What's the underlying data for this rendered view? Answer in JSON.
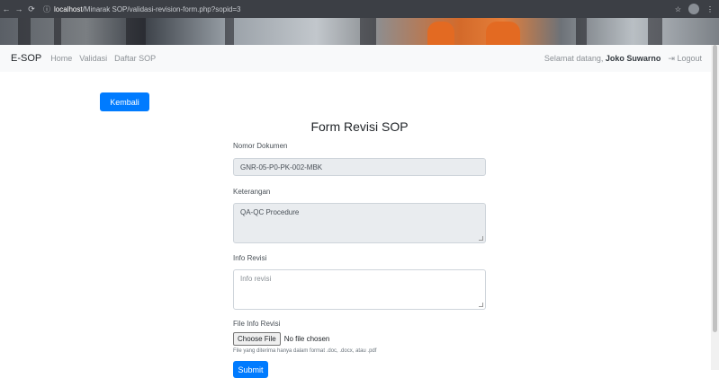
{
  "browser": {
    "url_host": "localhost",
    "url_path": "/Minarak SOP/validasi-revision-form.php?sopid=3"
  },
  "navbar": {
    "brand": "E-SOP",
    "links": [
      "Home",
      "Validasi",
      "Daftar SOP"
    ],
    "greeting": "Selamat datang,",
    "user_name": "Joko Suwarno",
    "logout": "Logout"
  },
  "back_button": "Kembali",
  "form": {
    "title": "Form Revisi SOP",
    "nomor_label": "Nomor Dokumen",
    "nomor_value": "GNR-05-P0-PK-002-MBK",
    "keterangan_label": "Keterangan",
    "keterangan_value": "QA-QC Procedure",
    "info_label": "Info Revisi",
    "info_placeholder": "Info revisi",
    "file_label": "File Info Revisi",
    "choose_file": "Choose File",
    "no_file": "No file chosen",
    "file_help": "File yang diterima hanya dalam format .doc, .docx, atau .pdf",
    "submit": "Submit"
  },
  "colors": {
    "primary": "#007bff",
    "navbar_bg": "#f8f9fa",
    "readonly_bg": "#e9ecef"
  }
}
